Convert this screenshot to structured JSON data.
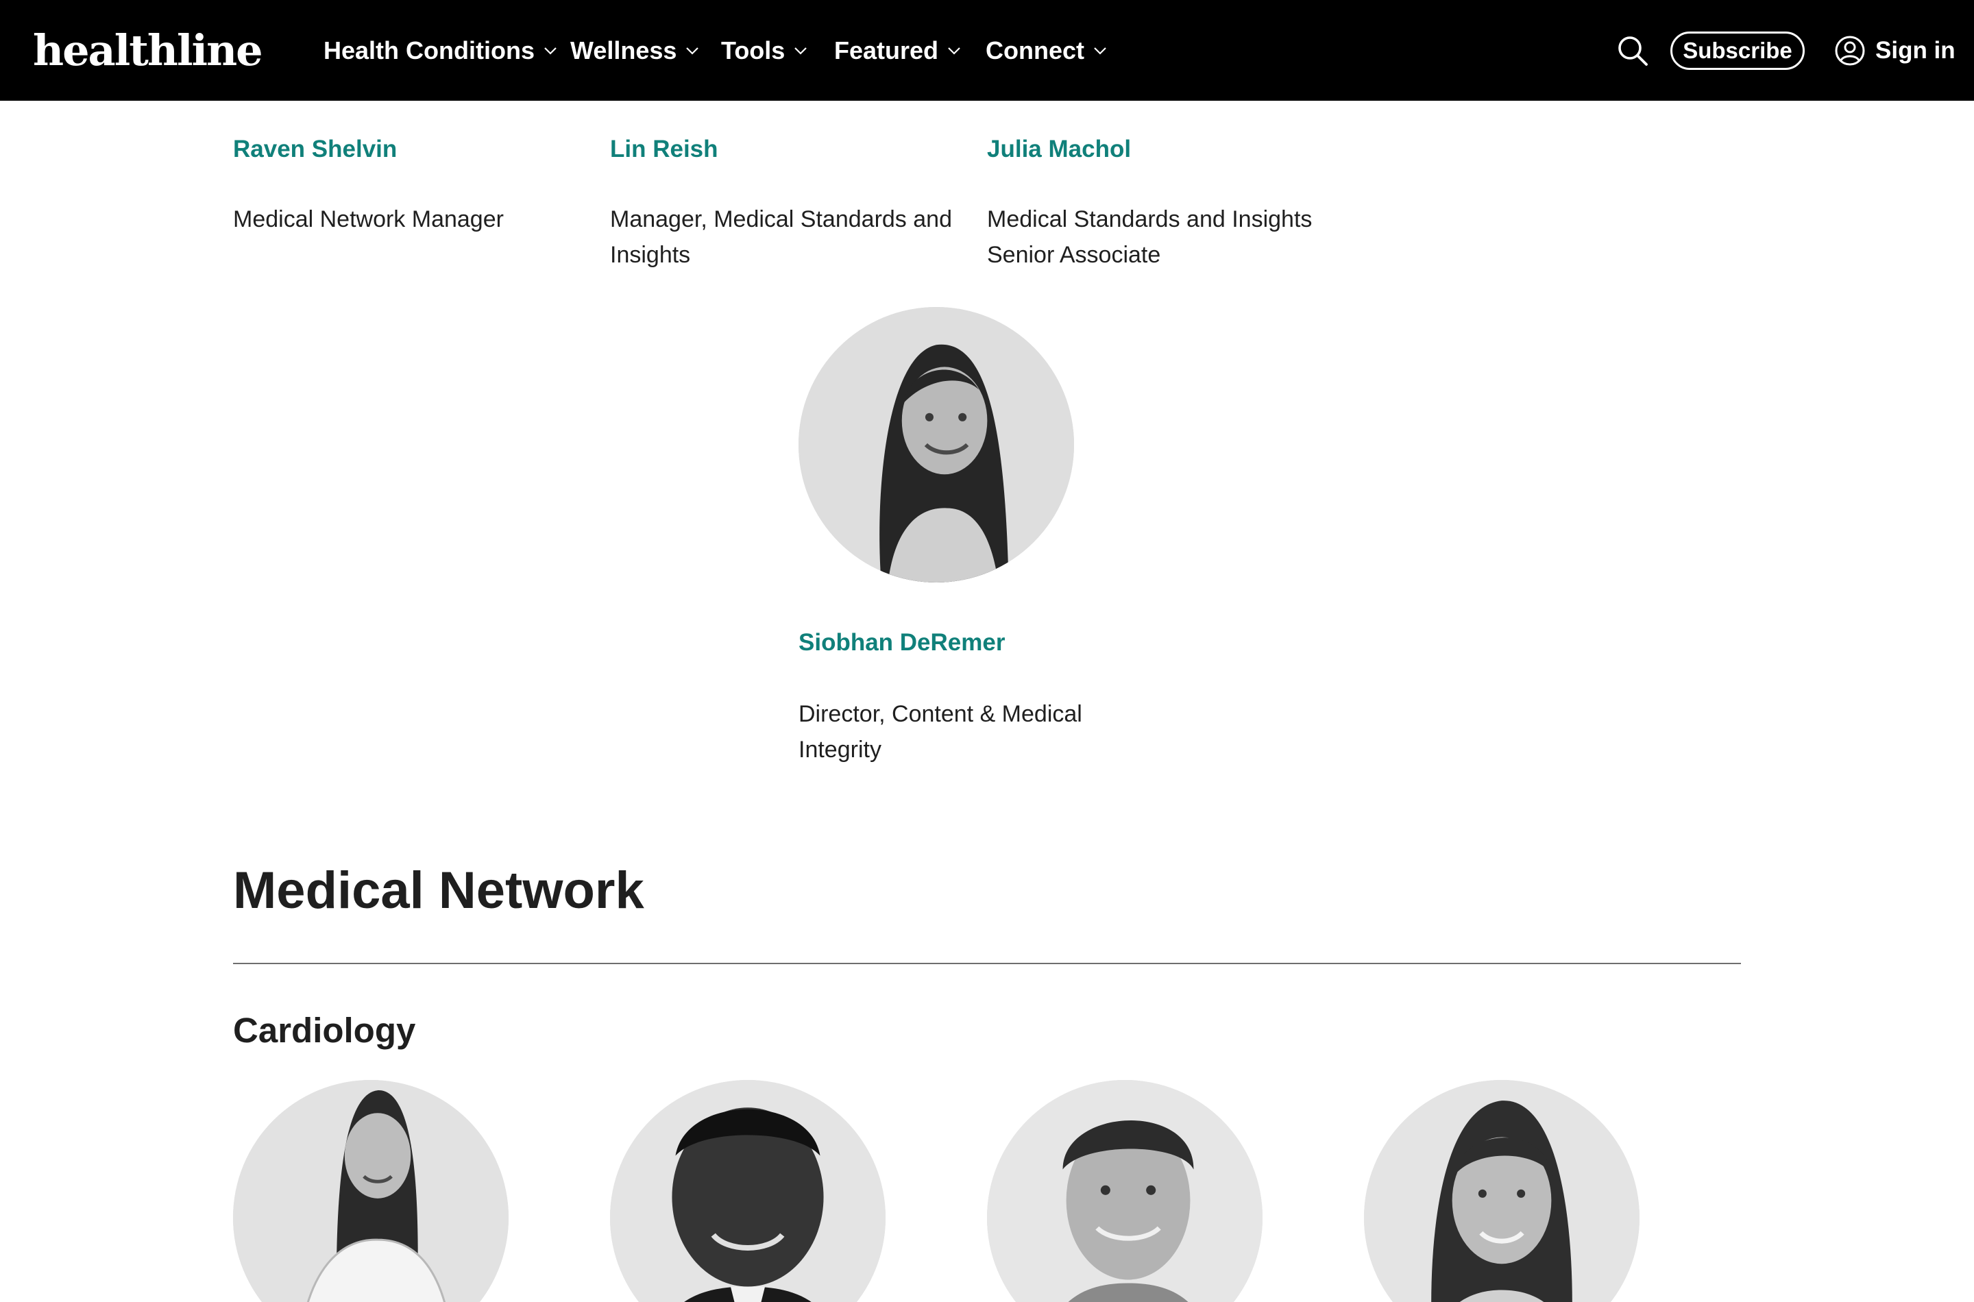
{
  "header": {
    "logo": "healthline",
    "nav": [
      {
        "label": "Health Conditions"
      },
      {
        "label": "Wellness"
      },
      {
        "label": "Tools"
      },
      {
        "label": "Featured"
      },
      {
        "label": "Connect"
      }
    ],
    "search_icon": "search-icon",
    "subscribe_label": "Subscribe",
    "signin_label": "Sign in",
    "signin_icon": "user-circle-icon"
  },
  "team_row": [
    {
      "name": "Raven Shelvin",
      "title": "Medical Network Manager"
    },
    {
      "name": "Lin Reish",
      "title": "Manager, Medical Standards and Insights"
    },
    {
      "name": "Julia Machol",
      "title": "Medical Standards and Insights Senior Associate"
    }
  ],
  "featured_person": {
    "name": "Siobhan DeRemer",
    "title": "Director, Content & Medical Integrity"
  },
  "section": {
    "title": "Medical Network",
    "subsection": "Cardiology"
  },
  "colors": {
    "header_bg": "#000000",
    "name_link": "#10807a",
    "text": "#1f1f1f",
    "divider": "#6e6e6e"
  }
}
